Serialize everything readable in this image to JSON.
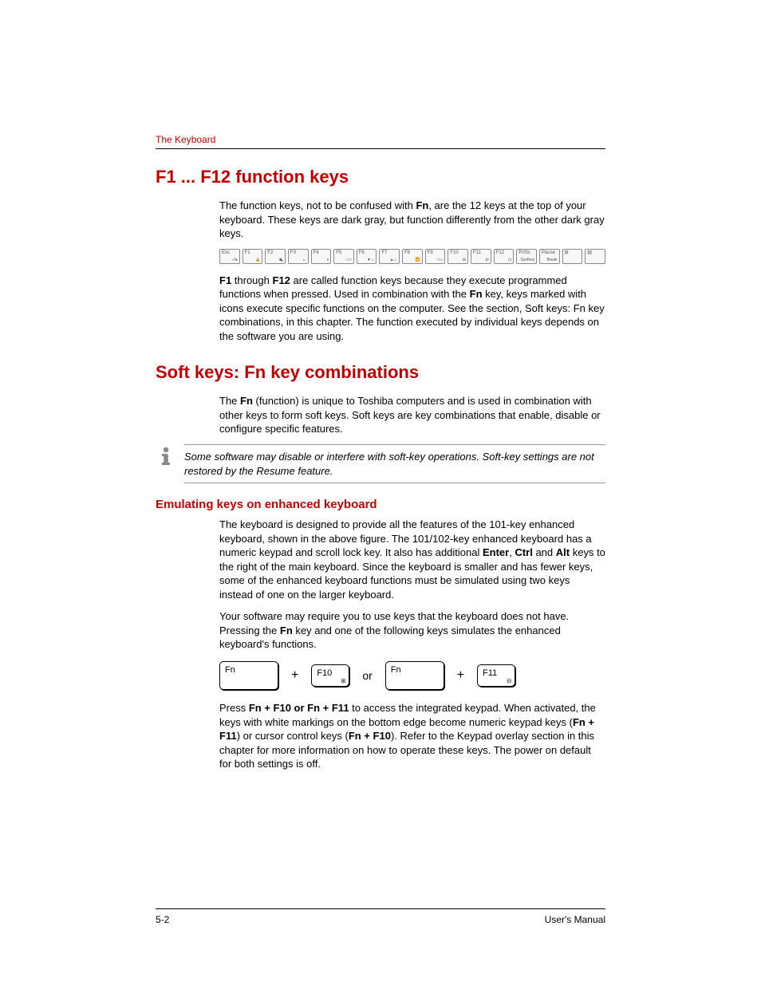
{
  "header": {
    "running_head": "The Keyboard"
  },
  "section1": {
    "title": "F1 ... F12 function keys",
    "para1_pre": "The function keys, not to be confused with ",
    "para1_b1": "Fn",
    "para1_post": ", are the 12 keys at the top of your keyboard. These keys are dark gray, but function differently from the other dark gray keys.",
    "fkeys": [
      {
        "top": "Esc",
        "bot": "○/●"
      },
      {
        "top": "F1",
        "bot": "🔒"
      },
      {
        "top": "F2",
        "bot": "🔌"
      },
      {
        "top": "F3",
        "bot": "⏾"
      },
      {
        "top": "F4",
        "bot": "⏸"
      },
      {
        "top": "F5",
        "bot": "▭□"
      },
      {
        "top": "F6",
        "bot": "▼☼"
      },
      {
        "top": "F7",
        "bot": "▲☼"
      },
      {
        "top": "F8",
        "bot": "📶"
      },
      {
        "top": "F9",
        "bot": "□▭"
      },
      {
        "top": "F10",
        "bot": "⊞"
      },
      {
        "top": "F11",
        "bot": "⊟"
      },
      {
        "top": "F12",
        "bot": "⊡"
      },
      {
        "top": "PrtSc",
        "bot": "SysReq"
      },
      {
        "top": "Pause",
        "bot": "Break"
      },
      {
        "top": "⊞",
        "bot": ""
      },
      {
        "top": "▤",
        "bot": ""
      }
    ],
    "para2_b1": "F1",
    "para2_mid1": " through ",
    "para2_b2": "F12",
    "para2_mid2": " are called function keys because they execute programmed functions when pressed. Used in combination with the ",
    "para2_b3": "Fn",
    "para2_post": " key, keys marked with icons execute specific functions on the computer. See the section, Soft keys: Fn key combinations, in this chapter. The function executed by individual keys depends on the software you are using."
  },
  "section2": {
    "title": "Soft keys: Fn key combinations",
    "para1_pre": "The ",
    "para1_b1": "Fn",
    "para1_post": " (function) is unique to Toshiba computers and is used in combination with other keys to form soft keys. Soft keys are key combinations that enable, disable or configure specific features.",
    "note": "Some software may disable or interfere with soft-key operations. Soft-key settings are not restored by the Resume feature.",
    "sub1": {
      "title": "Emulating keys on enhanced keyboard",
      "para1_pre": "The keyboard is designed to provide all the features of the 101-key enhanced keyboard, shown in the above figure. The 101/102-key enhanced keyboard has a numeric keypad and scroll lock key. It also has additional ",
      "para1_b1": "Enter",
      "para1_mid1": ", ",
      "para1_b2": "Ctrl",
      "para1_mid2": " and ",
      "para1_b3": "Alt",
      "para1_post": " keys to the right of the main keyboard. Since the keyboard is smaller and has fewer keys, some of the enhanced keyboard functions must be simulated using two keys instead of one on the larger keyboard.",
      "para2_pre": "Your software may require you to use keys that the keyboard does not have. Pressing the ",
      "para2_b1": "Fn",
      "para2_post": " key and one of the following keys simulates the enhanced keyboard's functions.",
      "combo": {
        "k1": "Fn",
        "plus1": "+",
        "k2": "F10",
        "or": "or",
        "k3": "Fn",
        "plus2": "+",
        "k4": "F11"
      },
      "para3_pre": "Press ",
      "para3_b1": "Fn + F10 or Fn + F11",
      "para3_mid1": " to access the integrated keypad. When activated, the keys with white markings on the bottom edge become numeric keypad keys (",
      "para3_b2": "Fn + F11",
      "para3_mid2": ") or cursor control keys (",
      "para3_b3": "Fn + F10",
      "para3_post": "). Refer to the Keypad overlay section in this chapter for more information on how to operate these keys. The power on default for both settings is off."
    }
  },
  "footer": {
    "page": "5-2",
    "manual": "User's Manual"
  }
}
